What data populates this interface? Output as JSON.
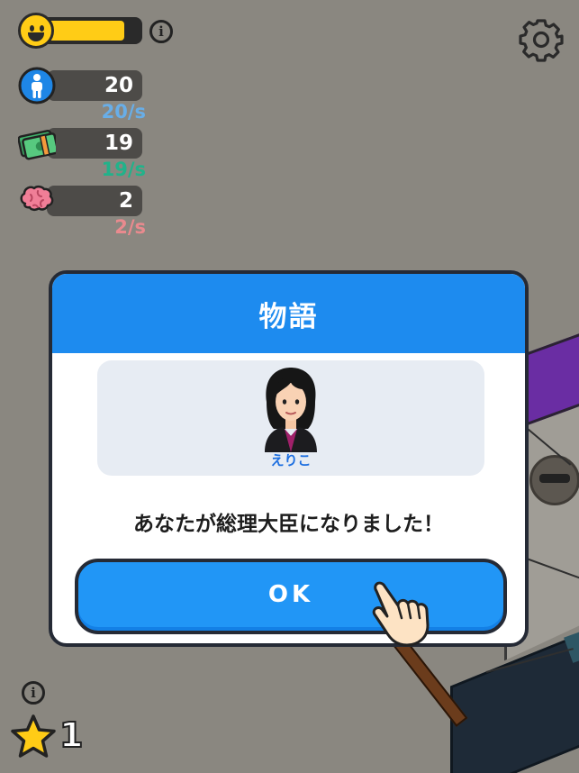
{
  "hud": {
    "happiness_level": 0.85,
    "stats": [
      {
        "icon": "population-icon",
        "value": "20",
        "rate": "20/s",
        "rate_color": "#68aee8"
      },
      {
        "icon": "money-icon",
        "value": "19",
        "rate": "19/s",
        "rate_color": "#22b28a"
      },
      {
        "icon": "brain-icon",
        "value": "2",
        "rate": "2/s",
        "rate_color": "#e98a8e"
      }
    ],
    "star_count": "1"
  },
  "dialog": {
    "title": "物語",
    "character_name": "えりこ",
    "message": "あなたが総理大臣になりました！",
    "ok_label": "OK"
  },
  "colors": {
    "accent": "#1d8bef",
    "happiness": "#ffcc16",
    "background": "#8a8780"
  }
}
